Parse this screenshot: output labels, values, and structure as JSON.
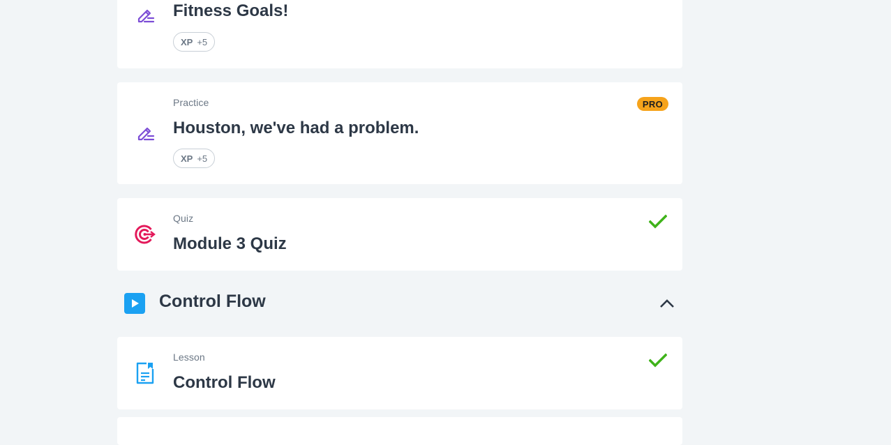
{
  "cards": [
    {
      "title": "Fitness Goals!",
      "icon": "edit-practice-icon",
      "xp_label": "XP",
      "xp_value": "+5"
    },
    {
      "type": "Practice",
      "title": "Houston, we've had a problem.",
      "icon": "edit-practice-icon",
      "badge": "PRO",
      "xp_label": "XP",
      "xp_value": "+5"
    },
    {
      "type": "Quiz",
      "title": "Module 3 Quiz",
      "icon": "target-quiz-icon",
      "status": "completed"
    },
    {
      "type": "Lesson",
      "title": "Control Flow",
      "icon": "lesson-document-icon",
      "status": "completed"
    }
  ],
  "section": {
    "title": "Control Flow",
    "icon": "play-icon",
    "expanded": true
  },
  "colors": {
    "background": "#f2f5f7",
    "practice_icon": "#7c4dd6",
    "quiz_icon": "#e3195a",
    "lesson_icon": "#1ba1f2",
    "check": "#3fb31a",
    "pro_badge": "#f6a31b"
  }
}
